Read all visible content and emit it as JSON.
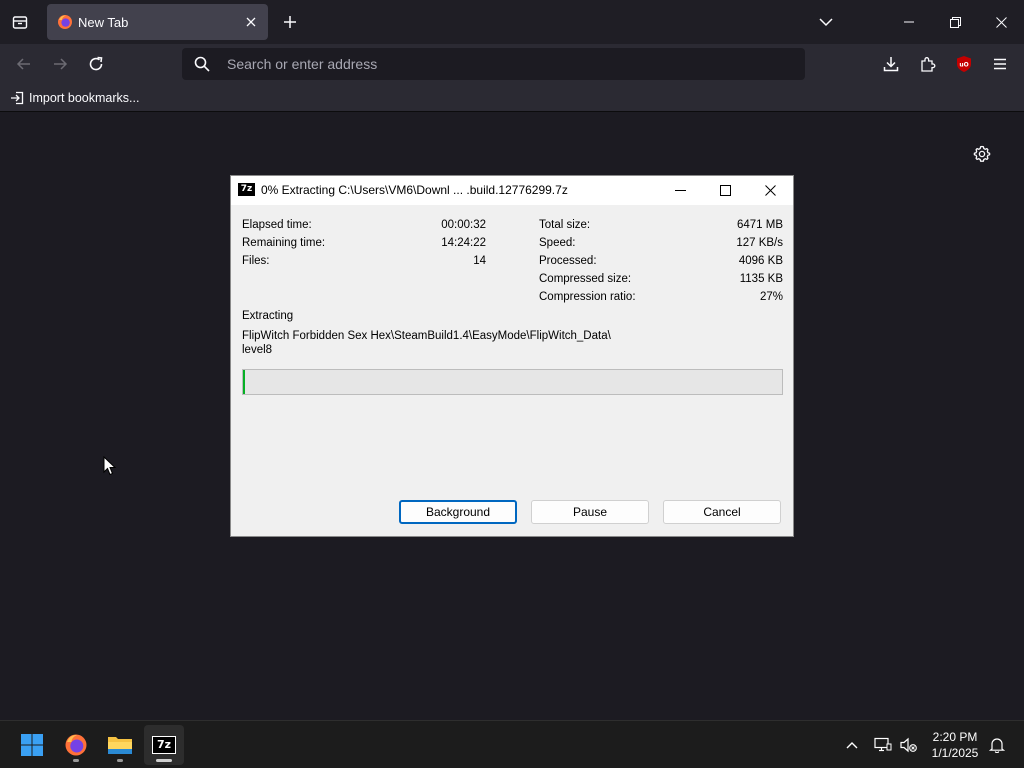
{
  "browser": {
    "tab": {
      "title": "New Tab"
    },
    "urlbar": {
      "placeholder": "Search or enter address",
      "value": ""
    },
    "bookmarks": {
      "import_label": "Import bookmarks..."
    }
  },
  "dialog": {
    "app_icon_text": "7z",
    "title": "0% Extracting C:\\Users\\VM6\\Downl ... .build.12776299.7z",
    "left_stats": [
      {
        "label": "Elapsed time:",
        "value": "00:00:32"
      },
      {
        "label": "Remaining time:",
        "value": "14:24:22"
      },
      {
        "label": "Files:",
        "value": "14"
      }
    ],
    "right_stats": [
      {
        "label": "Total size:",
        "value": "6471 MB"
      },
      {
        "label": "Speed:",
        "value": "127 KB/s"
      },
      {
        "label": "Processed:",
        "value": "4096 KB"
      },
      {
        "label": "Compressed size:",
        "value": "1135 KB"
      },
      {
        "label": "Compression ratio:",
        "value": "27%"
      }
    ],
    "status_label": "Extracting",
    "current_path_line1": "FlipWitch Forbidden Sex Hex\\SteamBuild1.4\\EasyMode\\FlipWitch_Data\\",
    "current_path_line2": "level8",
    "progress_fraction": 0.0,
    "buttons": {
      "background": "Background",
      "pause": "Pause",
      "cancel": "Cancel"
    }
  },
  "taskbar": {
    "apps": [
      "windows-start",
      "firefox",
      "file-explorer",
      "7-zip"
    ],
    "sevenzip_label": "7z",
    "clock": {
      "time": "2:20 PM",
      "date": "1/1/2025"
    }
  },
  "colors": {
    "browser_bg": "#1c1b22",
    "toolbar": "#2b2a33",
    "tab_active": "#42414d",
    "progress_green": "#06b025",
    "dialog_bg": "#f0f0f0",
    "default_button_border": "#0067c0",
    "ublock_red": "#c40000"
  }
}
